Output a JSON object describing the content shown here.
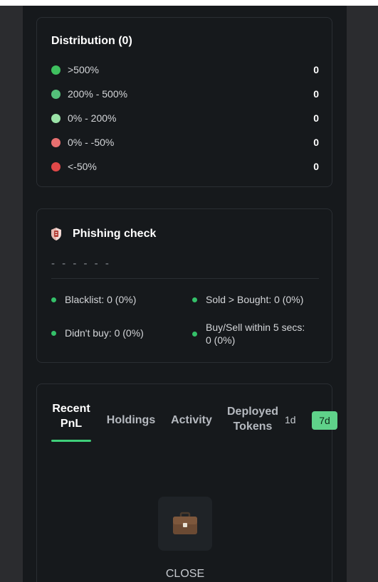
{
  "distribution": {
    "title": "Distribution (0)",
    "rows": [
      {
        "label": ">500%",
        "value": "0",
        "color": "#3fc05f"
      },
      {
        "label": "200% - 500%",
        "value": "0",
        "color": "#54c07a"
      },
      {
        "label": "0% - 200%",
        "value": "0",
        "color": "#9be3a8"
      },
      {
        "label": "0% - -50%",
        "value": "0",
        "color": "#e87070"
      },
      {
        "label": "<-50%",
        "value": "0",
        "color": "#e04848"
      }
    ]
  },
  "phishing": {
    "title": "Phishing check",
    "icon": "shield-icon",
    "dashes": "- - - - - -",
    "stats": [
      {
        "text": "Blacklist: 0 (0%)"
      },
      {
        "text": "Sold > Bought: 0 (0%)"
      },
      {
        "text": "Didn't buy: 0 (0%)"
      },
      {
        "line1": "Buy/Sell within 5 secs:",
        "line2": "0 (0%)"
      }
    ]
  },
  "tabs": {
    "items": [
      {
        "line1": "Recent",
        "line2": "PnL"
      },
      {
        "line1": "Holdings"
      },
      {
        "line1": "Activity"
      },
      {
        "line1": "Deployed",
        "line2": "Tokens"
      }
    ],
    "active": "Recent PnL",
    "range_1d": "1d",
    "range_7d": "7d",
    "empty_icon": "briefcase-icon",
    "close_label": "CLOSE",
    "accent": "#3fcf7a"
  }
}
